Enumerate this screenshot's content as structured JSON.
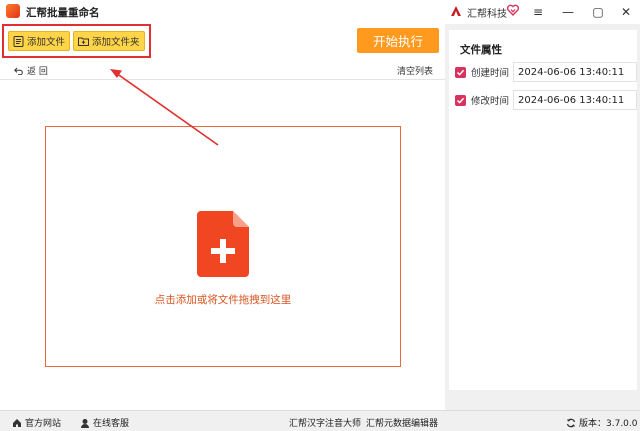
{
  "app": {
    "title": "汇帮批量重命名",
    "brand_name": "汇帮科技"
  },
  "window_controls": {
    "menu": "≡",
    "minimize": "—",
    "maximize": "▢",
    "close": "✕"
  },
  "toolbar": {
    "add_file_label": "添加文件",
    "add_folder_label": "添加文件夹",
    "start_label": "开始执行"
  },
  "subbar": {
    "back_label": "返  回",
    "clear_label": "清空列表"
  },
  "dropzone": {
    "hint": "点击添加或将文件拖拽到这里"
  },
  "side_panel": {
    "title": "文件属性",
    "rows": [
      {
        "label": "创建时间",
        "checked": true,
        "value": "2024-06-06 13:40:11"
      },
      {
        "label": "修改时间",
        "checked": true,
        "value": "2024-06-06 13:40:11"
      }
    ]
  },
  "statusbar": {
    "website_label": "官方网站",
    "support_label": "在线客服",
    "pinyin_tool_label": "汇帮汉字注音大师",
    "metadata_tool_label": "汇帮元数据编辑器",
    "version_label": "版本：3.7.0.0"
  },
  "colors": {
    "accent_orange": "#ff9a1e",
    "highlight_red": "#e03030",
    "checkbox": "#d7335e",
    "button_yellow": "#ffd447"
  }
}
